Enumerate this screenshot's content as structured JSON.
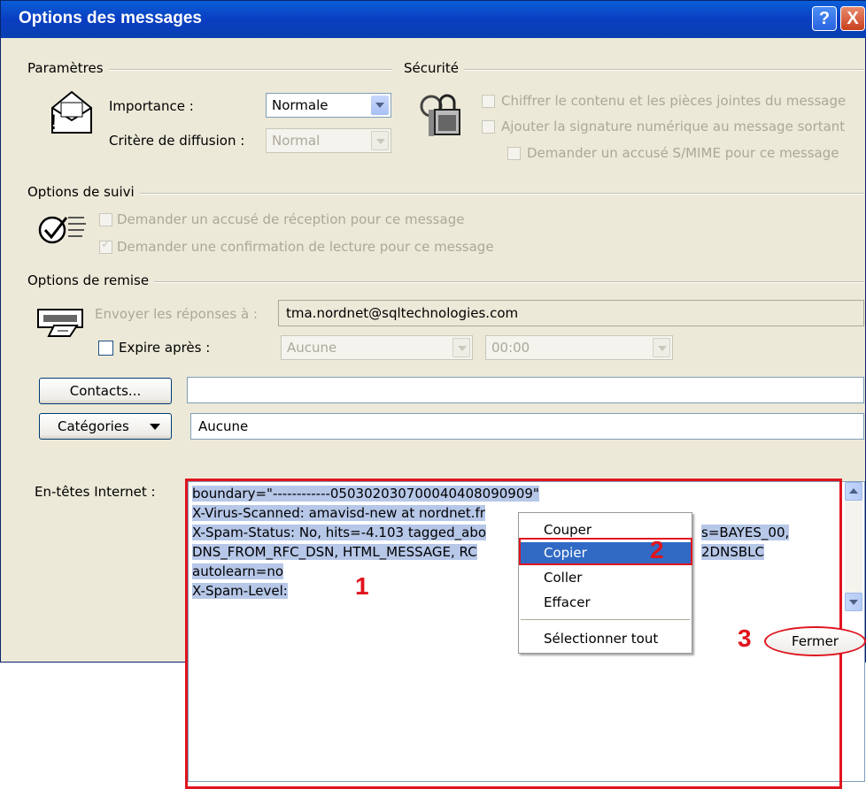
{
  "window": {
    "title": "Options des messages",
    "help_label": "?",
    "close_label": "X"
  },
  "settings": {
    "section": "Paramètres",
    "importance_label": "Importance :",
    "importance_value": "Normale",
    "sensitivity_label": "Critère de diffusion :",
    "sensitivity_value": "Normal"
  },
  "security": {
    "section": "Sécurité",
    "encrypt_label": "Chiffrer le contenu et les pièces jointes du message",
    "sign_label": "Ajouter la signature numérique au message sortant",
    "smime_label": "Demander un accusé S/MIME pour ce message"
  },
  "tracking": {
    "section": "Options de suivi",
    "delivery_receipt_label": "Demander un accusé de réception pour ce message",
    "read_receipt_label": "Demander une confirmation de lecture pour ce message"
  },
  "delivery": {
    "section": "Options de remise",
    "reply_to_label": "Envoyer les réponses à :",
    "reply_to_value": "tma.nordnet@sqltechnologies.com",
    "expires_label": "Expire après :",
    "expires_date": "Aucune",
    "expires_time": "00:00"
  },
  "contacts": {
    "button": "Contacts...",
    "value": ""
  },
  "categories": {
    "button": "Catégories",
    "value": "Aucune"
  },
  "headers": {
    "label": "En-têtes Internet :",
    "lines": [
      " boundary=\"------------050302030700040408090909\"",
      "X-Virus-Scanned: amavisd-new at nordnet.fr",
      "X-Spam-Status: No, hits=-4.103 tagged_abo",
      " DNS_FROM_RFC_DSN, HTML_MESSAGE, RC",
      "autolearn=no",
      "X-Spam-Level:"
    ],
    "line3_tail": "s=BAYES_00,",
    "line4_tail": "2DNSBLC"
  },
  "context_menu": {
    "cut": "Couper",
    "copy": "Copier",
    "paste": "Coller",
    "delete": "Effacer",
    "select_all": "Sélectionner tout"
  },
  "annotations": {
    "step1": "1",
    "step2": "2",
    "step3": "3"
  },
  "close_button": "Fermer"
}
